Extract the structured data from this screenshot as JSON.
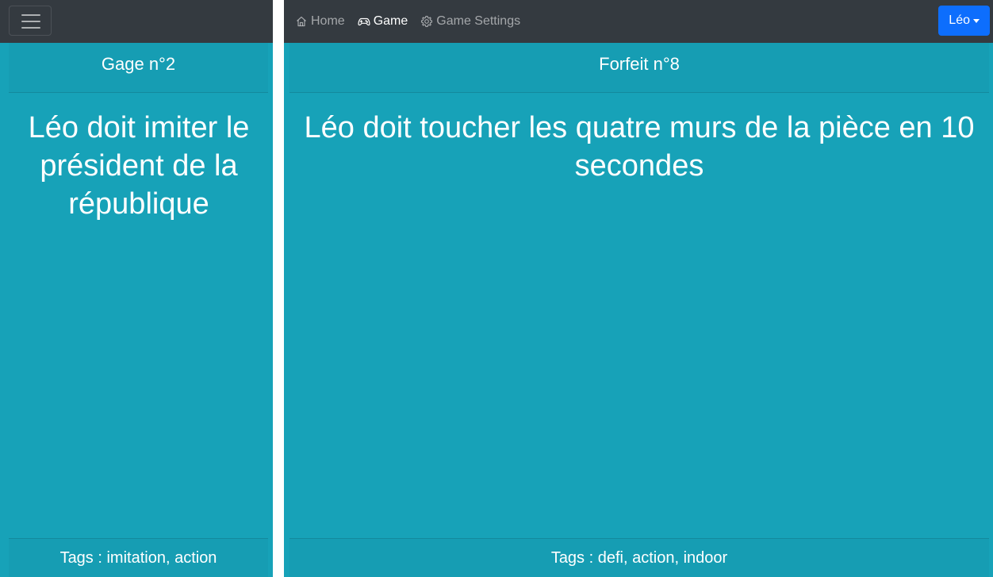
{
  "left_view": {
    "menu_toggle_icon": "hamburger-menu-icon",
    "card": {
      "header": "Gage n°2",
      "text": "Léo doit imiter le président de la république",
      "tags": "Tags : imitation, action"
    }
  },
  "right_view": {
    "nav": {
      "home": {
        "label": "Home",
        "icon": "house-icon"
      },
      "game": {
        "label": "Game",
        "icon": "gamepad-icon"
      },
      "settings": {
        "label": "Game Settings",
        "icon": "gear-icon"
      }
    },
    "user_menu": {
      "label": "Léo"
    },
    "card": {
      "header": "Forfeit n°8",
      "text": "Léo doit toucher les quatre murs de la pièce en 10 secondes",
      "tags": "Tags : defi, action, indoor"
    }
  },
  "colors": {
    "navbar_bg": "#343a40",
    "card_bg": "#17a2b8",
    "user_button_bg": "#0d6efd"
  }
}
